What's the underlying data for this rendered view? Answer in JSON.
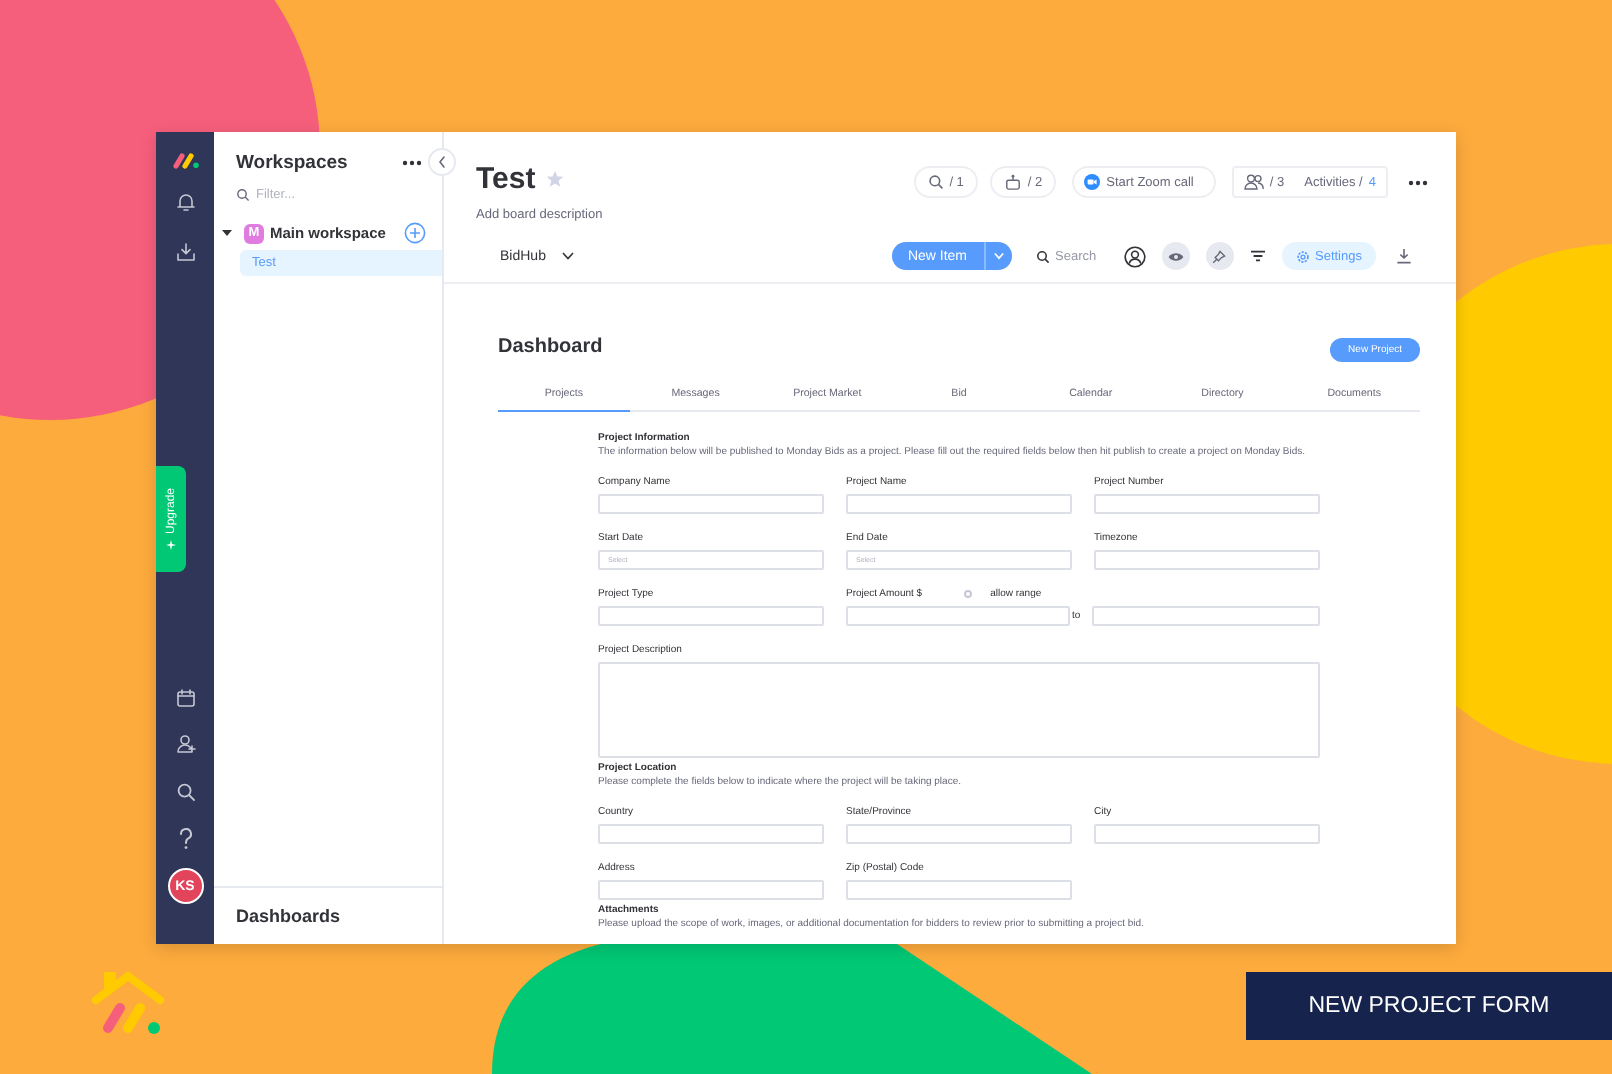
{
  "nav": {
    "upgrade": "Upgrade",
    "avatar": "KS"
  },
  "workspaces": {
    "title": "Workspaces",
    "filter_placeholder": "Filter...",
    "workspace": {
      "name": "Main workspace",
      "initial": "M",
      "expanded": true
    },
    "items": [
      {
        "label": "Test",
        "selected": true
      }
    ],
    "footer": "Dashboards"
  },
  "board": {
    "title": "Test",
    "description": "Add board description",
    "badges": [
      {
        "kind": "search",
        "count": "/ 1"
      },
      {
        "kind": "robot",
        "count": "/ 2"
      }
    ],
    "zoom_button": "Start Zoom call",
    "members": "/ 3",
    "activities": "Activities /",
    "activities_count": "4",
    "view": "BidHub",
    "new_item": "New Item",
    "search_placeholder": "Search",
    "settings": "Settings"
  },
  "dashboard": {
    "title": "Dashboard",
    "new_project": "New Project",
    "tabs": [
      {
        "label": "Projects",
        "selected": true
      },
      {
        "label": "Messages",
        "selected": false
      },
      {
        "label": "Project Market",
        "selected": false
      },
      {
        "label": "Bid",
        "selected": false
      },
      {
        "label": "Calendar",
        "selected": false
      },
      {
        "label": "Directory",
        "selected": false
      },
      {
        "label": "Documents",
        "selected": false
      }
    ],
    "sections": [
      {
        "title": "Project Information",
        "description": "The information below will be published to Monday Bids as a project. Please fill out the required fields below then hit publish to create a project on Monday Bids.",
        "rows": [
          [
            {
              "kind": "text",
              "label": "Company Name"
            },
            {
              "kind": "text",
              "label": "Project Name"
            },
            {
              "kind": "text",
              "label": "Project Number"
            }
          ],
          [
            {
              "kind": "text",
              "label": "Start Date",
              "placeholder": "Select"
            },
            {
              "kind": "text",
              "label": "End Date",
              "placeholder": "Select"
            },
            {
              "kind": "text",
              "label": "Timezone"
            }
          ],
          [
            {
              "kind": "text",
              "label": "Project Type"
            },
            {
              "kind": "range",
              "label": "Project Amount $",
              "option": "allow range",
              "checked": false,
              "separator": "to"
            }
          ],
          [
            {
              "kind": "textarea",
              "label": "Project Description"
            }
          ]
        ]
      },
      {
        "title": "Project Location",
        "description": "Please complete the fields below to indicate where the project will be taking place.",
        "rows": [
          [
            {
              "kind": "text",
              "label": "Country"
            },
            {
              "kind": "text",
              "label": "State/Province"
            },
            {
              "kind": "text",
              "label": "City"
            }
          ],
          [
            {
              "kind": "text",
              "label": "Address"
            },
            {
              "kind": "text",
              "label": "Zip (Postal) Code"
            }
          ]
        ]
      },
      {
        "title": "Attachments",
        "description": "Please upload the scope of work, images, or additional documentation for bidders to review prior to submitting a project bid."
      }
    ]
  },
  "caption": "NEW PROJECT FORM"
}
